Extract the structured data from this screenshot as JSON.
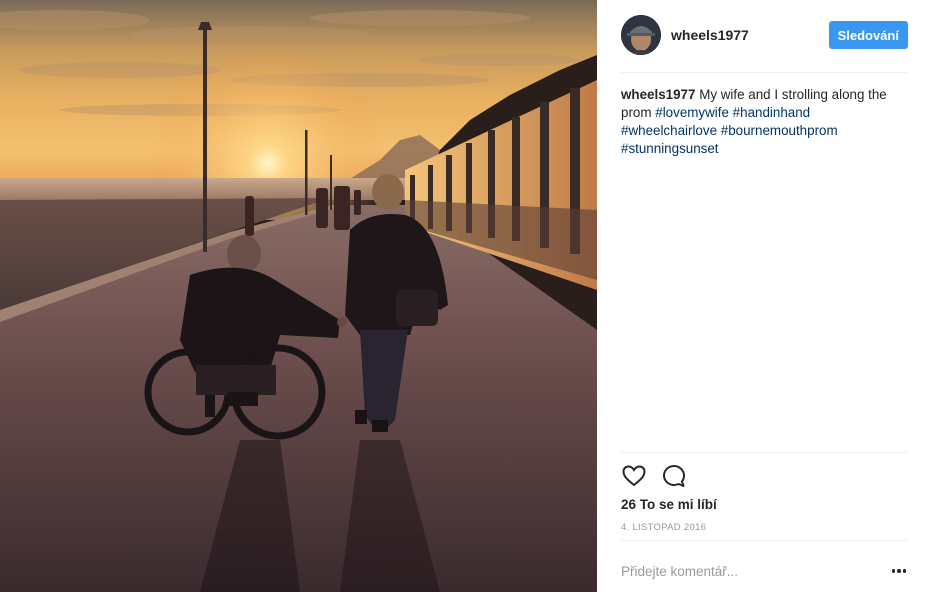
{
  "post": {
    "image": {
      "alt": ""
    },
    "author": {
      "username": "wheels1977",
      "follow_label": "Sledování"
    },
    "caption": {
      "username": "wheels1977",
      "text": "My wife and I strolling along the prom",
      "hashtags": [
        "#lovemywife",
        "#handinhand",
        "#wheelchairlove",
        "#bournemouthprom",
        "#stunningsunset"
      ]
    },
    "actions": {
      "like_icon": "heart-icon",
      "comment_icon": "comment-icon"
    },
    "likes_text": "26 To se mi líbí",
    "date": "4. LISTOPAD 2016",
    "comment": {
      "placeholder": "Přidejte komentář...",
      "value": ""
    },
    "more_icon": "more-options-icon"
  },
  "colors": {
    "follow_button": "#3897f0",
    "hashtag": "#003569",
    "text": "#262626",
    "muted": "#999999",
    "divider": "#efefef"
  }
}
